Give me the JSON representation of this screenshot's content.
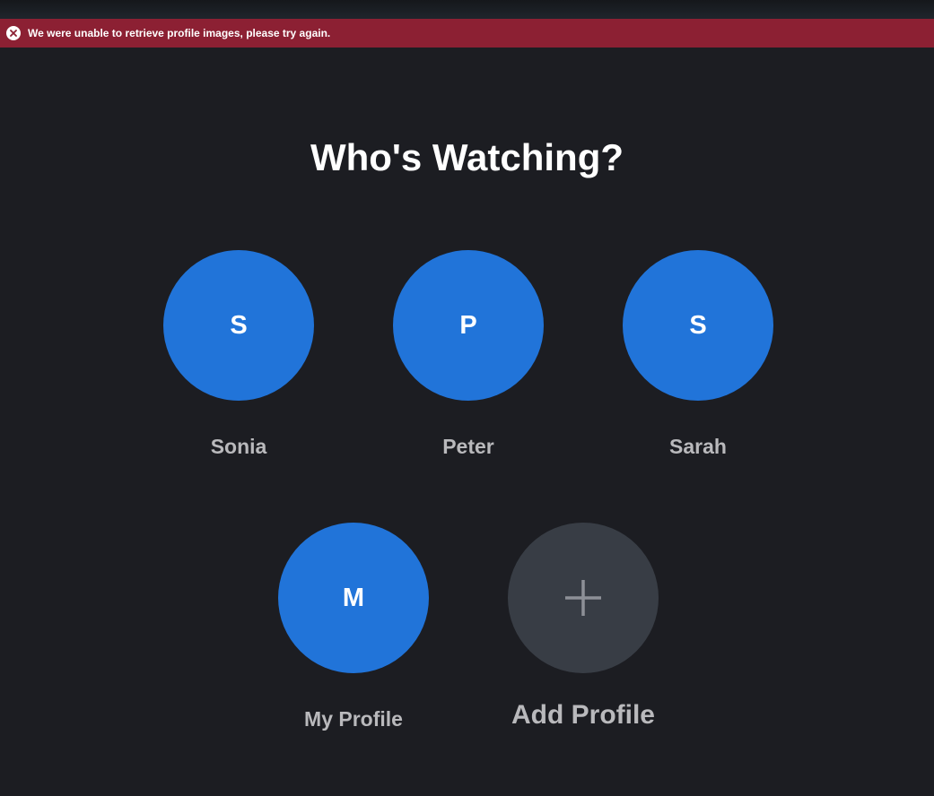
{
  "banner": {
    "message": "We were unable to retrieve profile images, please try again.",
    "icon": "close-circle-icon",
    "color": "#8c2033"
  },
  "page": {
    "title": "Who's Watching?",
    "background": "#1c1d22"
  },
  "profiles": [
    {
      "initial": "S",
      "name": "Sonia"
    },
    {
      "initial": "P",
      "name": "Peter"
    },
    {
      "initial": "S",
      "name": "Sarah"
    },
    {
      "initial": "M",
      "name": "My Profile"
    }
  ],
  "add_profile": {
    "label": "Add Profile",
    "icon": "plus-icon"
  },
  "colors": {
    "avatar": "#2174d9",
    "add_avatar": "#383d45",
    "name_text": "#b9b9bc"
  }
}
